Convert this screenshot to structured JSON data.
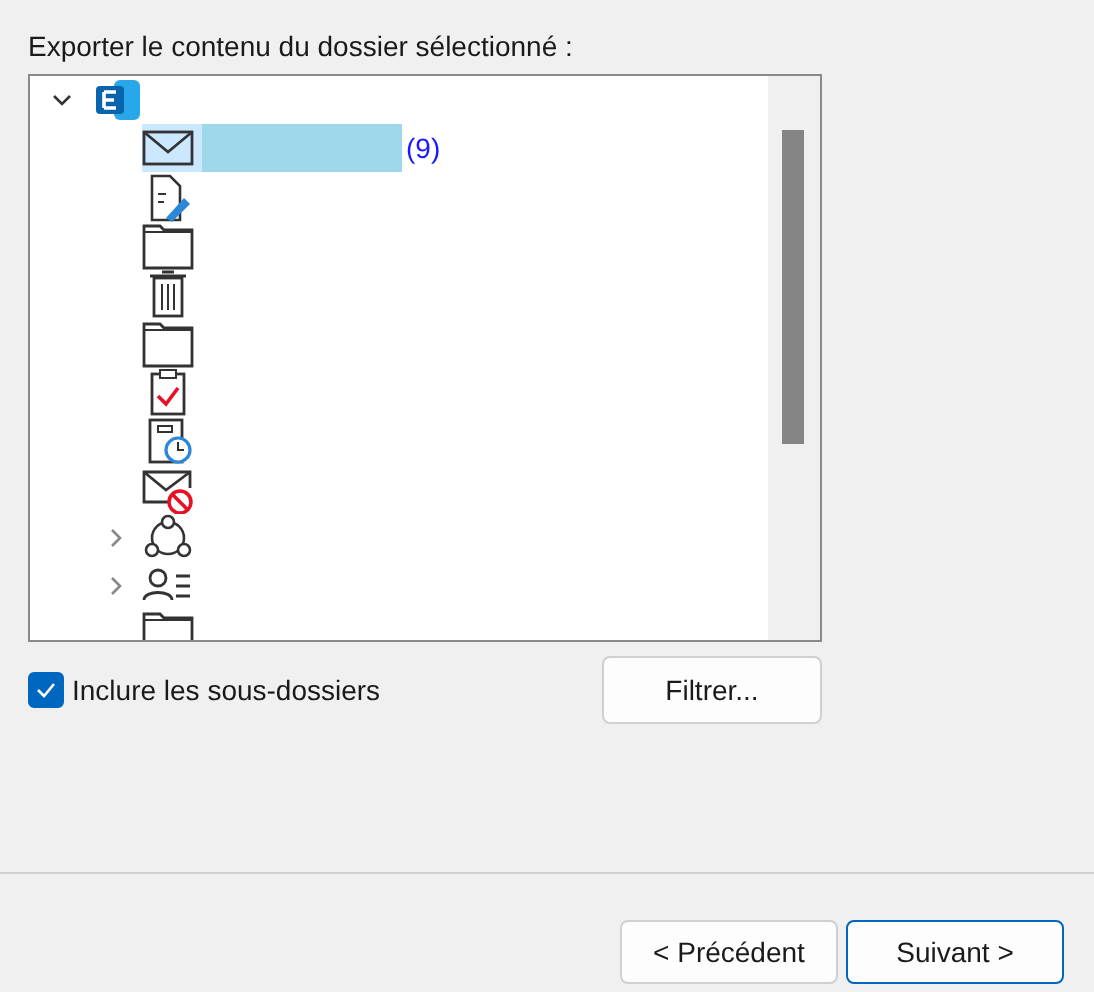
{
  "prompt": "Exporter le contenu du dossier sélectionné :",
  "folder_tree": {
    "root": {
      "kind": "exchange",
      "expanded": true,
      "children": [
        {
          "kind": "inbox",
          "selected": true,
          "count": "(9)"
        },
        {
          "kind": "drafts",
          "selected": false
        },
        {
          "kind": "folder",
          "selected": false
        },
        {
          "kind": "trash",
          "selected": false
        },
        {
          "kind": "folder",
          "selected": false
        },
        {
          "kind": "tasks",
          "selected": false
        },
        {
          "kind": "scheduled",
          "selected": false
        },
        {
          "kind": "junk",
          "selected": false
        },
        {
          "kind": "conversation",
          "selected": false,
          "expanded": false
        },
        {
          "kind": "contacts",
          "selected": false,
          "expanded": false
        },
        {
          "kind": "folder",
          "selected": false
        }
      ]
    }
  },
  "include_subfolders": {
    "label": "Inclure les sous-dossiers",
    "checked": true
  },
  "filter_button": "Filtrer...",
  "buttons": [
    "< Précédent",
    "Suivant >"
  ]
}
